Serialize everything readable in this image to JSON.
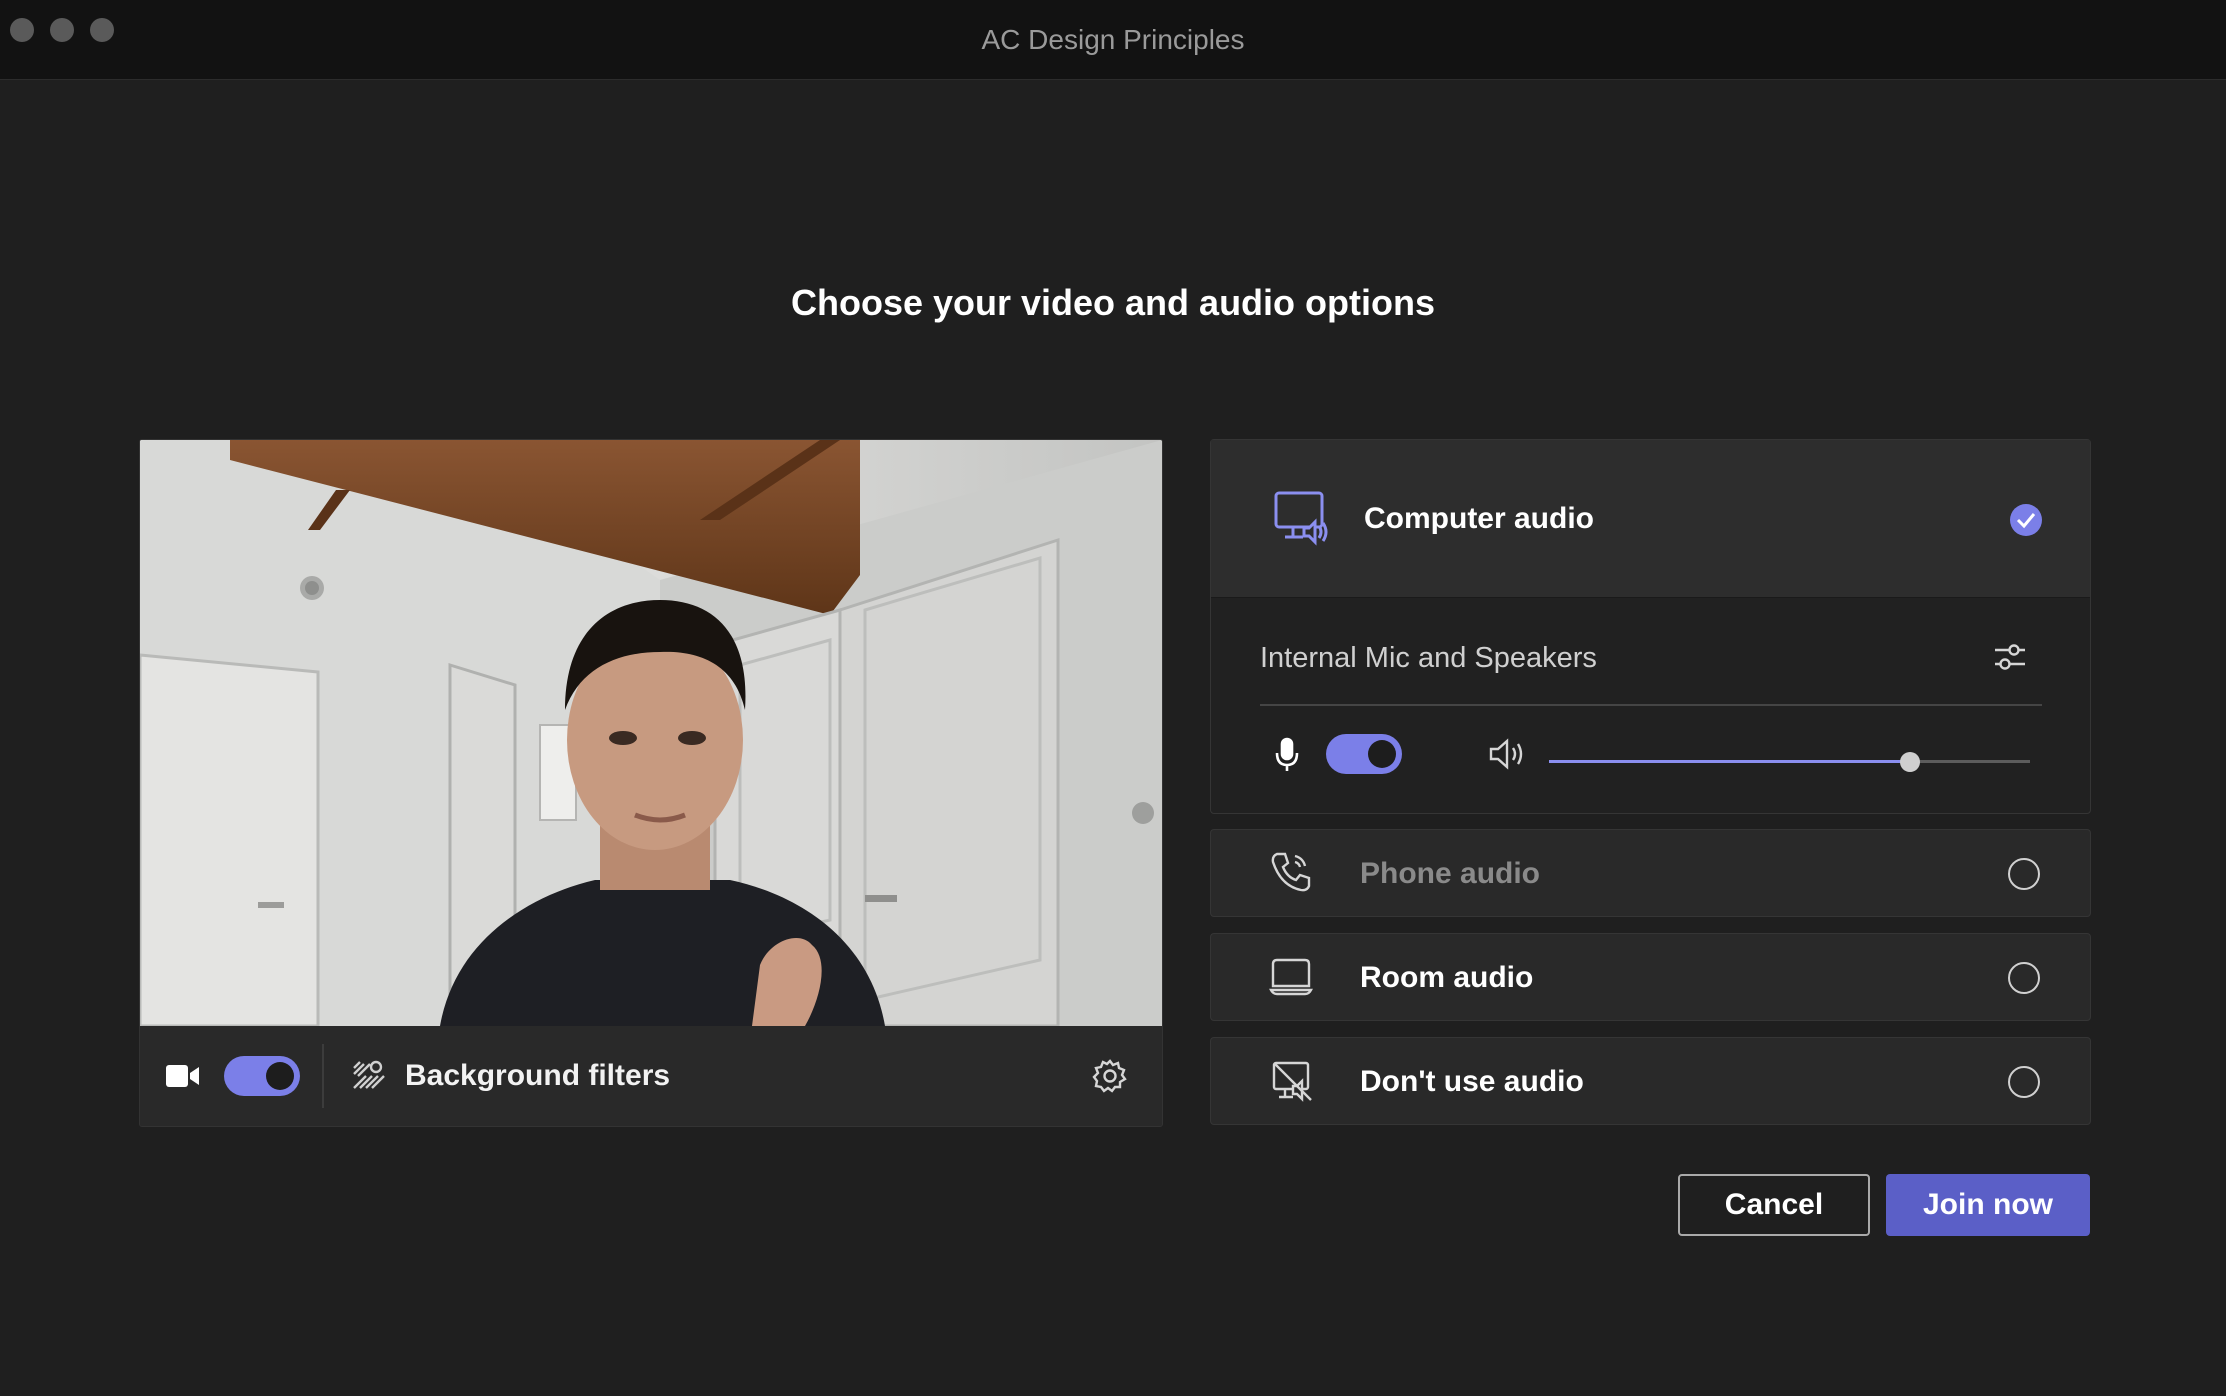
{
  "window": {
    "title": "AC Design Principles"
  },
  "page": {
    "heading": "Choose your video and audio options"
  },
  "video": {
    "camera_on": true,
    "background_filters_label": "Background filters"
  },
  "audio": {
    "computer_audio": {
      "label": "Computer audio",
      "selected": true,
      "device_label": "Internal Mic and Speakers",
      "mic_on": true,
      "speaker_volume_percent": 75
    },
    "options": [
      {
        "label": "Phone audio",
        "selected": false,
        "disabled": true
      },
      {
        "label": "Room audio",
        "selected": false,
        "disabled": false
      },
      {
        "label": "Don't use audio",
        "selected": false,
        "disabled": false
      }
    ]
  },
  "actions": {
    "cancel_label": "Cancel",
    "join_label": "Join now"
  },
  "colors": {
    "accent": "#7b7fe8",
    "join_button": "#5b5fc7",
    "background": "#1f1f1f",
    "card": "#292929"
  },
  "icons": {
    "camera": "video-camera-icon",
    "background_filters": "background-effects-icon",
    "settings": "gear-icon",
    "computer_audio": "computer-speaker-icon",
    "selected": "checkmark-circle-icon",
    "device_settings": "sliders-icon",
    "microphone": "microphone-icon",
    "speaker": "speaker-icon",
    "phone": "phone-icon",
    "room": "room-device-icon",
    "no_audio": "speaker-off-icon"
  }
}
